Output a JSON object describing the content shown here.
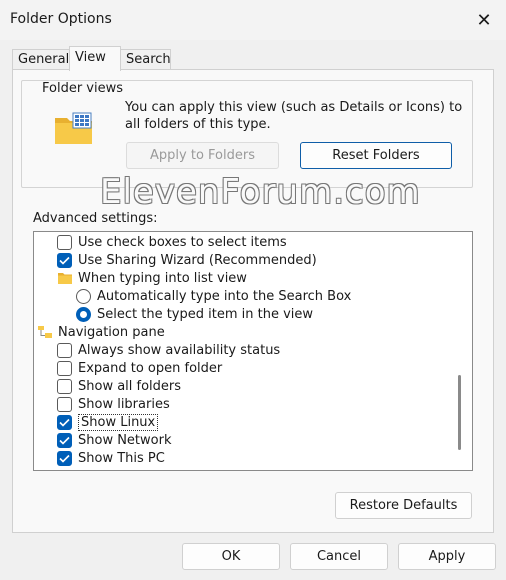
{
  "window": {
    "title": "Folder Options"
  },
  "tabs": [
    {
      "label": "General"
    },
    {
      "label": "View"
    },
    {
      "label": "Search"
    }
  ],
  "folder_views": {
    "title": "Folder views",
    "description": "You can apply this view (such as Details or Icons) to all folders of this type.",
    "apply_button": "Apply to Folders",
    "reset_button": "Reset Folders"
  },
  "watermark": "ElevenForum.com",
  "advanced": {
    "label": "Advanced settings:",
    "items": [
      {
        "label": "Use check boxes to select items",
        "kind": "checkbox",
        "checked": false
      },
      {
        "label": "Use Sharing Wizard (Recommended)",
        "kind": "checkbox",
        "checked": true
      },
      {
        "label": "When typing into list view",
        "kind": "folder"
      },
      {
        "label": "Automatically type into the Search Box",
        "kind": "radio",
        "checked": false
      },
      {
        "label": "Select the typed item in the view",
        "kind": "radio",
        "checked": true
      },
      {
        "label": "Navigation pane",
        "kind": "tree"
      },
      {
        "label": "Always show availability status",
        "kind": "checkbox",
        "checked": false
      },
      {
        "label": "Expand to open folder",
        "kind": "checkbox",
        "checked": false
      },
      {
        "label": "Show all folders",
        "kind": "checkbox",
        "checked": false
      },
      {
        "label": "Show libraries",
        "kind": "checkbox",
        "checked": false
      },
      {
        "label": "Show Linux",
        "kind": "checkbox",
        "checked": true
      },
      {
        "label": "Show Network",
        "kind": "checkbox",
        "checked": true
      },
      {
        "label": "Show This PC",
        "kind": "checkbox",
        "checked": true
      }
    ]
  },
  "buttons": {
    "restore_defaults": "Restore Defaults",
    "ok": "OK",
    "cancel": "Cancel",
    "apply": "Apply"
  },
  "colors": {
    "accent": "#005fb8",
    "folder": "#f7c948"
  }
}
